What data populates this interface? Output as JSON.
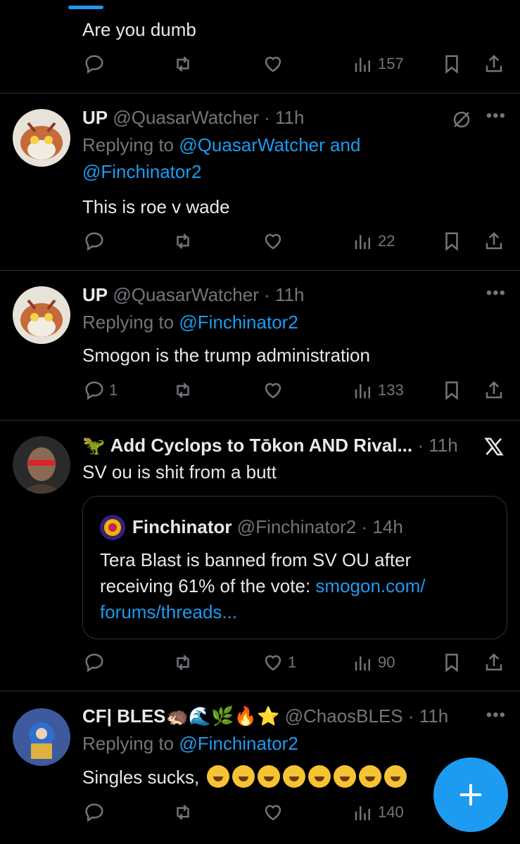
{
  "tweets": [
    {
      "text": "Are you dumb",
      "views": "157"
    },
    {
      "name": "UP",
      "handle": "@QuasarWatcher",
      "time": "· 11h",
      "replying_prefix": "Replying to ",
      "replying_to": "@QuasarWatcher and",
      "replying_to_2": "@Finchinator2",
      "text": "This is roe v wade",
      "views": "22"
    },
    {
      "name": "UP",
      "handle": "@QuasarWatcher",
      "time": "· 11h",
      "replying_prefix": "Replying to ",
      "replying_to": "@Finchinator2",
      "text": "Smogon is the trump administration",
      "replies": "1",
      "views": "133"
    },
    {
      "name_emoji": "🦖",
      "name": "Add Cyclops to Tōkon AND Rival...",
      "time": "· 11h",
      "text": "SV ou is shit from a butt",
      "quote": {
        "name": "Finchinator",
        "handle": "@Finchinator2",
        "time": "· 14h",
        "text_line1": "Tera Blast is banned from SV OU after",
        "text_line2": "receiving 61% of the vote: ",
        "link1": "smogon.com/",
        "link2": "forums/threads..."
      },
      "likes": "1",
      "views": "90"
    },
    {
      "name": "CF| BLES",
      "name_emojis": "🦔🌊🌿🔥⭐",
      "handle": "@ChaosBLES",
      "time": "· 11h",
      "replying_prefix": "Replying to ",
      "replying_to": "@Finchinator2",
      "text": "Singles sucks,",
      "views": "140"
    }
  ],
  "icons": {
    "reply": "reply-icon",
    "retweet": "retweet-icon",
    "like": "heart-icon",
    "views": "views-icon",
    "bookmark": "bookmark-icon",
    "share": "share-icon",
    "more": "more-icon",
    "compose": "plus-icon"
  },
  "colors": {
    "accent": "#1d9bf0",
    "muted": "#71767b",
    "text": "#e7e9ea",
    "border": "#2f3336"
  }
}
